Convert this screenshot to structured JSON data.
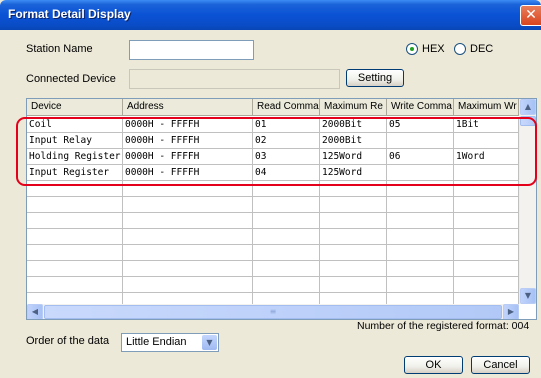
{
  "window": {
    "title": "Format Detail Display",
    "close_glyph": "✕"
  },
  "station": {
    "label": "Station Name",
    "value": ""
  },
  "format_radio": {
    "hex_label": "HEX",
    "dec_label": "DEC",
    "selected": "HEX"
  },
  "connected": {
    "label": "Connected Device",
    "value": "",
    "setting_label": "Setting"
  },
  "table": {
    "columns": [
      "Device",
      "Address",
      "Read Comma",
      "Maximum Re",
      "Write Comma",
      "Maximum Wr"
    ],
    "rows": [
      [
        "Coil",
        "0000H - FFFFH",
        "01",
        "2000Bit",
        "05",
        "1Bit"
      ],
      [
        "Input Relay",
        "0000H - FFFFH",
        "02",
        "2000Bit",
        "",
        ""
      ],
      [
        "Holding Register",
        "0000H - FFFFH",
        "03",
        "125Word",
        "06",
        "1Word"
      ],
      [
        "Input Register",
        "0000H - FFFFH",
        "04",
        "125Word",
        "",
        ""
      ]
    ],
    "empty_row_count": 9
  },
  "registered": {
    "text": "Number of the registered format: 004"
  },
  "order": {
    "label": "Order of the data",
    "value": "Little Endian"
  },
  "buttons": {
    "ok": "OK",
    "cancel": "Cancel"
  },
  "icons": {
    "up": "▲",
    "down": "▼",
    "left": "◀",
    "right": "▶",
    "grip": "≡",
    "dropdown": "▼"
  },
  "colors": {
    "title_bar": "#0a52d5",
    "highlight": "#e4001b",
    "radio_dot": "#21a121"
  }
}
